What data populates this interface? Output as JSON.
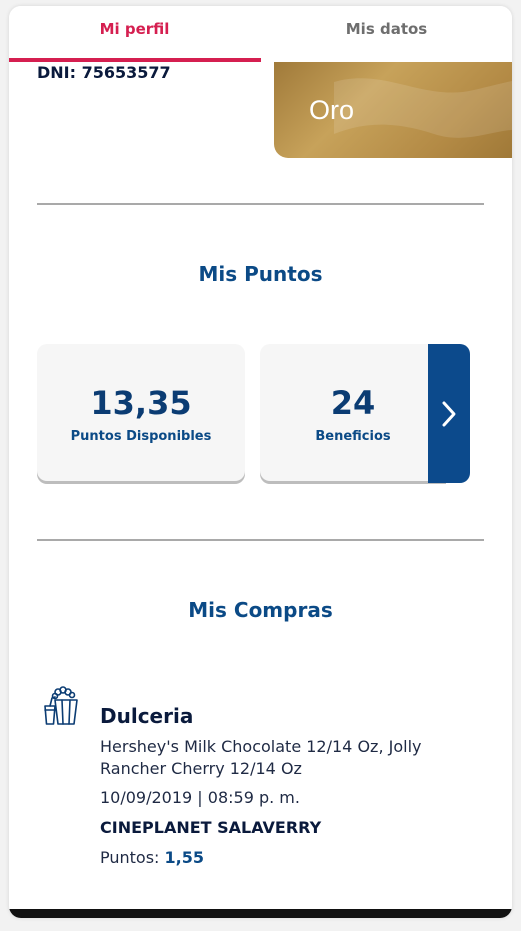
{
  "tabs": [
    {
      "label": "Mi perfil",
      "active": true
    },
    {
      "label": "Mis datos",
      "active": false
    }
  ],
  "profile": {
    "dni": "DNI: 75653577",
    "card_level": "Oro"
  },
  "points_section": {
    "title": "Mis Puntos",
    "available_value": "13,35",
    "available_label": "Puntos Disponibles",
    "benefits_value": "24",
    "benefits_label": "Beneficios"
  },
  "purchases_section": {
    "title": "Mis Compras",
    "items": [
      {
        "icon": "popcorn-drink-icon",
        "category": "Dulceria",
        "description": "Hershey's Milk Chocolate 12/14 Oz, Jolly Rancher Cherry 12/14 Oz",
        "datetime": "10/09/2019 | 08:59 p. m.",
        "store": "CINEPLANET SALAVERRY",
        "points_label": "Puntos:",
        "points_value": "1,55"
      }
    ]
  },
  "colors": {
    "accent_red": "#d51f50",
    "primary_blue": "#0b4a86",
    "gold": "#b38a45"
  }
}
